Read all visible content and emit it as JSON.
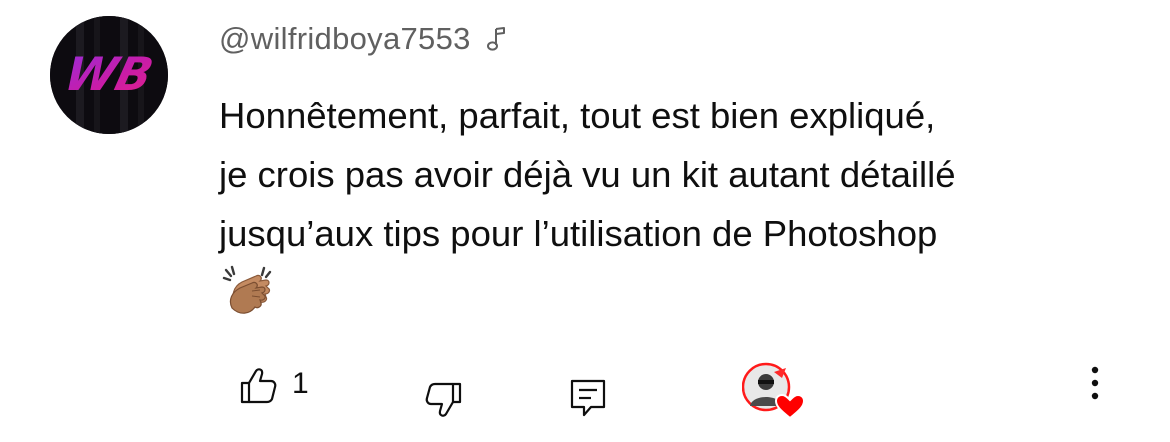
{
  "comment": {
    "author": "@wilfridboya7553",
    "author_avatar_text": "WB",
    "author_badge_icon": "music-note-icon",
    "lines": [
      "Honnêtement, parfait, tout est bien expliqué,",
      "je crois pas avoir déjà vu un kit autant détaillé",
      "jusqu’aux tips pour l’utilisation de Photoshop"
    ],
    "emoji": "👏🏽",
    "like_count": "1"
  },
  "actions": {
    "like_icon": "thumbs-up-icon",
    "dislike_icon": "thumbs-down-icon",
    "reply_icon": "reply-icon",
    "creator_heart_icon": "creator-heart-icon",
    "more_icon": "more-vertical-icon"
  },
  "colors": {
    "text_primary": "#0f0f0f",
    "text_secondary": "#606060",
    "heart": "#ff0000",
    "avatar_magenta": "#c2189e",
    "avatar_purple": "#8e2bd6"
  }
}
